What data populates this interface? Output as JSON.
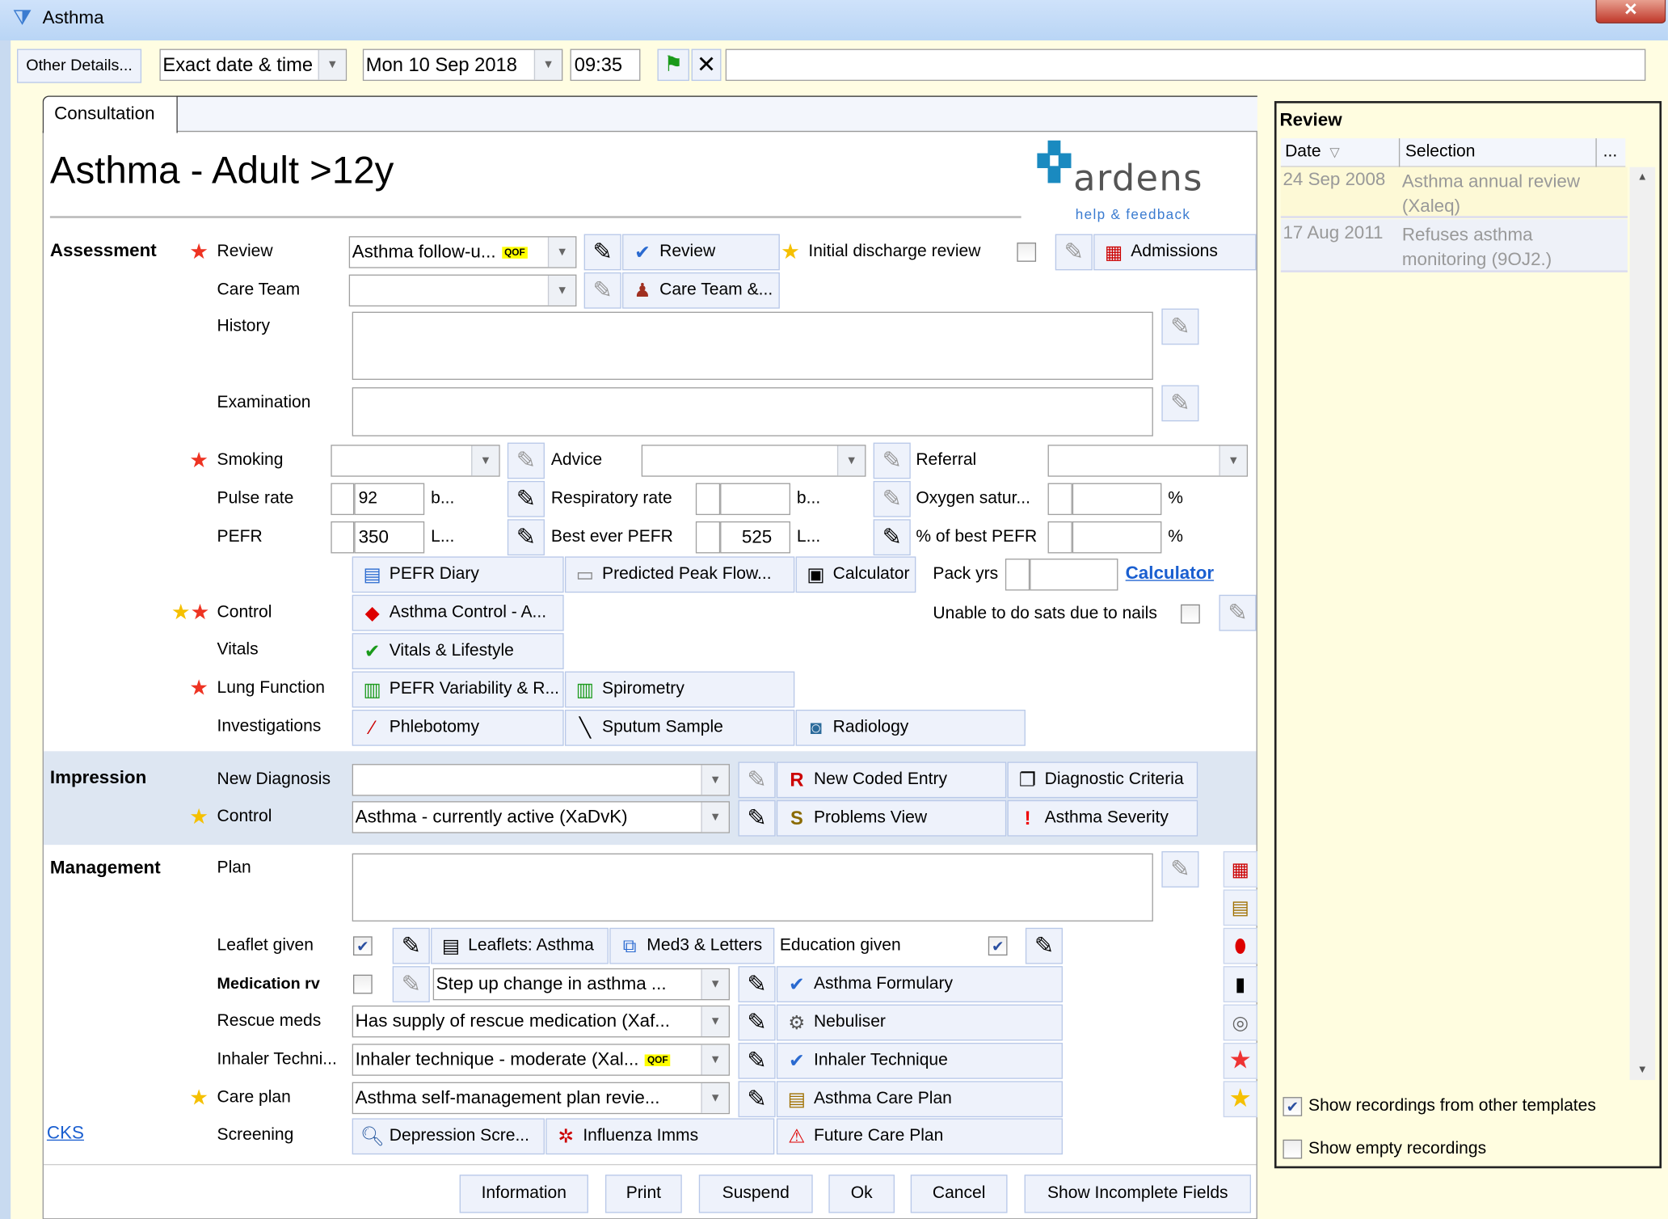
{
  "window": {
    "title": "Asthma",
    "close_icon": "close-icon"
  },
  "toolbar": {
    "other_details": "Other Details...",
    "date_mode": "Exact date & time",
    "date": "Mon 10 Sep 2018",
    "time": "09:35",
    "free_text": ""
  },
  "tab": "Consultation",
  "template_title": "Asthma - Adult >12y",
  "logo": {
    "text": "ardens",
    "link": "help & feedback"
  },
  "assessment": {
    "heading": "Assessment",
    "review_label": "Review",
    "review_value": "Asthma follow-u...",
    "qof": "QOF",
    "review_button": "Review",
    "initial_discharge": "Initial discharge review",
    "initial_discharge_checked": false,
    "admissions": "Admissions",
    "care_team_label": "Care Team",
    "care_team_value": "",
    "care_team_button": "Care Team &...",
    "history_label": "History",
    "history_value": "",
    "examination_label": "Examination",
    "examination_value": "",
    "smoking_label": "Smoking",
    "smoking_value": "",
    "advice_label": "Advice",
    "advice_value": "",
    "referral_label": "Referral",
    "referral_value": "",
    "pulse_label": "Pulse rate",
    "pulse_value": "92",
    "pulse_unit": "b...",
    "resp_label": "Respiratory rate",
    "resp_value": "",
    "resp_unit": "b...",
    "oxygen_label": "Oxygen satur...",
    "oxygen_value": "",
    "oxygen_unit": "%",
    "pefr_label": "PEFR",
    "pefr_value": "350",
    "pefr_unit": "L...",
    "best_pefr_label": "Best ever PEFR",
    "best_pefr_value": "525",
    "best_pefr_unit": "L...",
    "pct_best_label": "% of best PEFR",
    "pct_best_value": "",
    "pct_best_unit": "%",
    "pefr_diary": "PEFR Diary",
    "predicted_peak": "Predicted Peak Flow...",
    "calculator_button": "Calculator",
    "pack_yrs_label": "Pack yrs",
    "pack_yrs_value": "",
    "calculator_link": "Calculator",
    "control_label": "Control",
    "asthma_control": "Asthma Control - A...",
    "unable_sats": "Unable to do sats due to nails",
    "unable_sats_checked": false,
    "vitals_label": "Vitals",
    "vitals_button": "Vitals & Lifestyle",
    "lung_label": "Lung Function",
    "pefr_variability": "PEFR Variability & R...",
    "spirometry": "Spirometry",
    "investigations_label": "Investigations",
    "phlebotomy": "Phlebotomy",
    "sputum": "Sputum Sample",
    "radiology": "Radiology"
  },
  "impression": {
    "heading": "Impression",
    "new_diagnosis_label": "New Diagnosis",
    "new_diagnosis_value": "",
    "new_coded_entry": "New Coded Entry",
    "diagnostic_criteria": "Diagnostic Criteria",
    "control_label": "Control",
    "control_value": "Asthma - currently active (XaDvK)",
    "problems_view": "Problems View",
    "asthma_severity": "Asthma Severity"
  },
  "management": {
    "heading": "Management",
    "plan_label": "Plan",
    "plan_value": "",
    "leaflet_label": "Leaflet given",
    "leaflet_checked": true,
    "leaflets_button": "Leaflets: Asthma",
    "med3_button": "Med3 & Letters",
    "education_label": "Education given",
    "education_checked": true,
    "medication_label": "Medication rv",
    "medication_checked": false,
    "medication_value": "Step up change in asthma ...",
    "formulary": "Asthma Formulary",
    "rescue_label": "Rescue meds",
    "rescue_value": "Has supply of rescue medication (Xaf...",
    "nebuliser": "Nebuliser",
    "inhaler_label": "Inhaler Techni...",
    "inhaler_value": "Inhaler technique - moderate (Xal...",
    "qof": "QOF",
    "inhaler_button": "Inhaler Technique",
    "care_plan_label": "Care plan",
    "care_plan_value": "Asthma self-management plan revie...",
    "care_plan_button": "Asthma Care Plan",
    "screening_label": "Screening",
    "depression": "Depression Scre...",
    "influenza": "Influenza Imms",
    "future_care": "Future Care Plan",
    "cks_link": "CKS",
    "side_icons": [
      "calendar-icon",
      "clipboard-icon",
      "pill-icon",
      "bottle-icon",
      "coins-icon",
      "red-star-icon",
      "yellow-star-icon"
    ]
  },
  "footer": {
    "information": "Information",
    "print": "Print",
    "suspend": "Suspend",
    "ok": "Ok",
    "cancel": "Cancel",
    "show_incomplete": "Show Incomplete Fields"
  },
  "review_panel": {
    "title": "Review",
    "columns": [
      "Date",
      "Selection",
      "..."
    ],
    "rows": [
      {
        "date": "24 Sep 2008",
        "selection": "Asthma annual review (Xaleq)"
      },
      {
        "date": "17 Aug 2011",
        "selection": "Refuses asthma monitoring (9OJ2.)"
      }
    ],
    "show_other_templates": "Show recordings from other templates",
    "show_other_templates_checked": true,
    "show_empty": "Show empty recordings",
    "show_empty_checked": false
  },
  "colors": {
    "required_star": "#ee3322",
    "optional_star": "#f5c000",
    "link": "#1a5fd0",
    "panel_bg": "#fffde2",
    "impression_bg": "#dde6f2"
  }
}
